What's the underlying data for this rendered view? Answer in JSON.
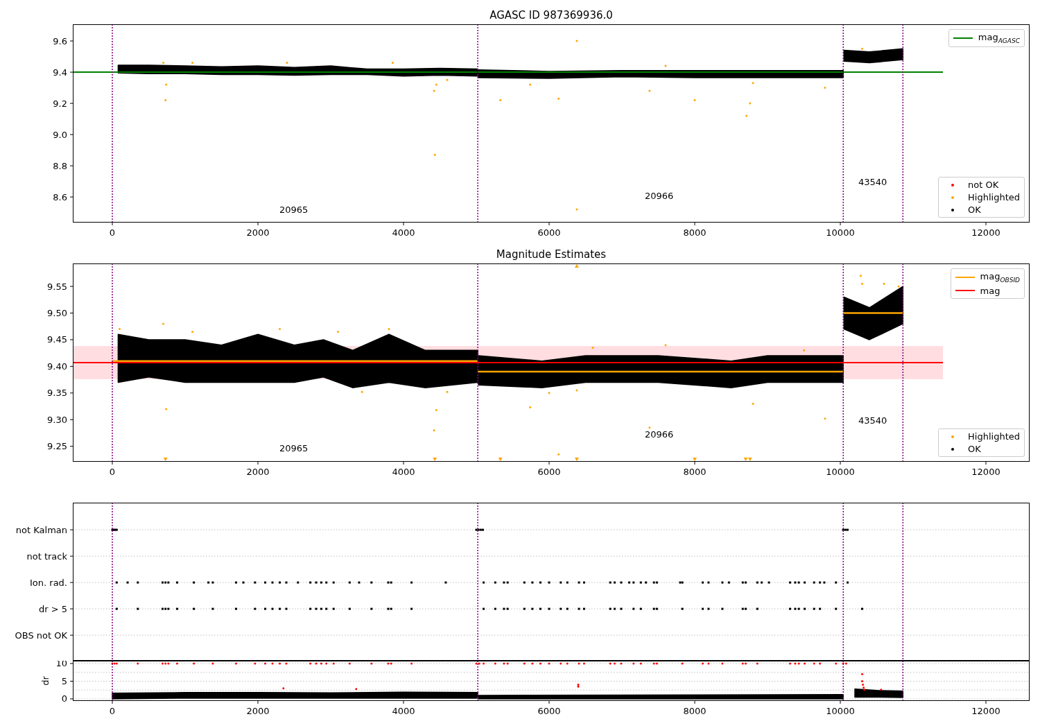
{
  "panels": [
    {
      "title": "AGASC ID 987369936.0",
      "y_tick_labels": [
        "9.6",
        "9.4",
        "9.2",
        "9.0",
        "8.8",
        "8.6"
      ],
      "x_tick_labels": [
        "0",
        "2000",
        "4000",
        "6000",
        "8000",
        "10000",
        "12000"
      ],
      "segment_labels": [
        "20965",
        "20966",
        "43540"
      ],
      "legends": [
        {
          "items": [
            {
              "label": "mag$_{AGASC}$",
              "kind": "line",
              "color": "#008000"
            }
          ]
        },
        {
          "items": [
            {
              "label": "not OK",
              "kind": "dot",
              "color": "#ff0000"
            },
            {
              "label": "Highlighted",
              "kind": "dot",
              "color": "#ffa500"
            },
            {
              "label": "OK",
              "kind": "dot",
              "color": "#000000"
            }
          ]
        }
      ]
    },
    {
      "title": "Magnitude Estimates",
      "y_tick_labels": [
        "9.55",
        "9.50",
        "9.45",
        "9.40",
        "9.35",
        "9.30",
        "9.25"
      ],
      "x_tick_labels": [
        "0",
        "2000",
        "4000",
        "6000",
        "8000",
        "10000",
        "12000"
      ],
      "segment_labels": [
        "20965",
        "20966",
        "43540"
      ],
      "legends": [
        {
          "items": [
            {
              "label": "mag$_{OBSID}$",
              "kind": "line",
              "color": "#ffa500"
            },
            {
              "label": "mag",
              "kind": "line",
              "color": "#ff0000"
            }
          ]
        },
        {
          "items": [
            {
              "label": "Highlighted",
              "kind": "dot",
              "color": "#ffa500"
            },
            {
              "label": "OK",
              "kind": "dot",
              "color": "#000000"
            }
          ]
        }
      ]
    },
    {
      "y_tick_labels": [
        "not Kalman",
        "not track",
        "Ion. rad.",
        "dr > 5",
        "OBS not OK"
      ]
    },
    {
      "ylabel": "dr",
      "y_tick_labels": [
        "10",
        "5",
        "0"
      ],
      "x_tick_labels": [
        "0",
        "2000",
        "4000",
        "6000",
        "8000",
        "10000",
        "12000"
      ]
    }
  ]
}
